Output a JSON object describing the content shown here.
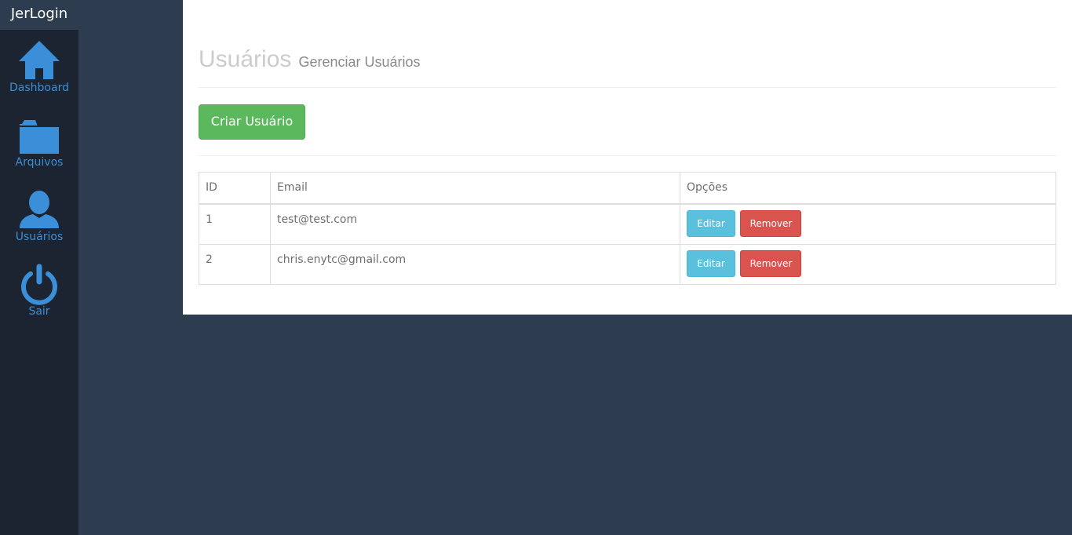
{
  "app": {
    "brand": "JerLogin"
  },
  "sidebar": {
    "items": [
      {
        "label": "Dashboard",
        "icon": "home-icon"
      },
      {
        "label": "Arquivos",
        "icon": "folder-icon"
      },
      {
        "label": "Usuários",
        "icon": "user-icon"
      },
      {
        "label": "Sair",
        "icon": "power-icon"
      }
    ],
    "accent_color": "#3b8fd8"
  },
  "header": {
    "title": "Usuários",
    "subtitle": "Gerenciar Usuários"
  },
  "actions": {
    "create_label": "Criar Usuário"
  },
  "table": {
    "columns": [
      "ID",
      "Email",
      "Opções"
    ],
    "rows": [
      {
        "id": "1",
        "email": "test@test.com",
        "edit_label": "Editar",
        "remove_label": "Remover"
      },
      {
        "id": "2",
        "email": "chris.enytc@gmail.com",
        "edit_label": "Editar",
        "remove_label": "Remover"
      }
    ]
  },
  "colors": {
    "success": "#5cb85c",
    "info": "#5bc0de",
    "danger": "#d9534f",
    "sidebar_bg": "#1b2430",
    "page_bg": "#2e3c4f"
  }
}
